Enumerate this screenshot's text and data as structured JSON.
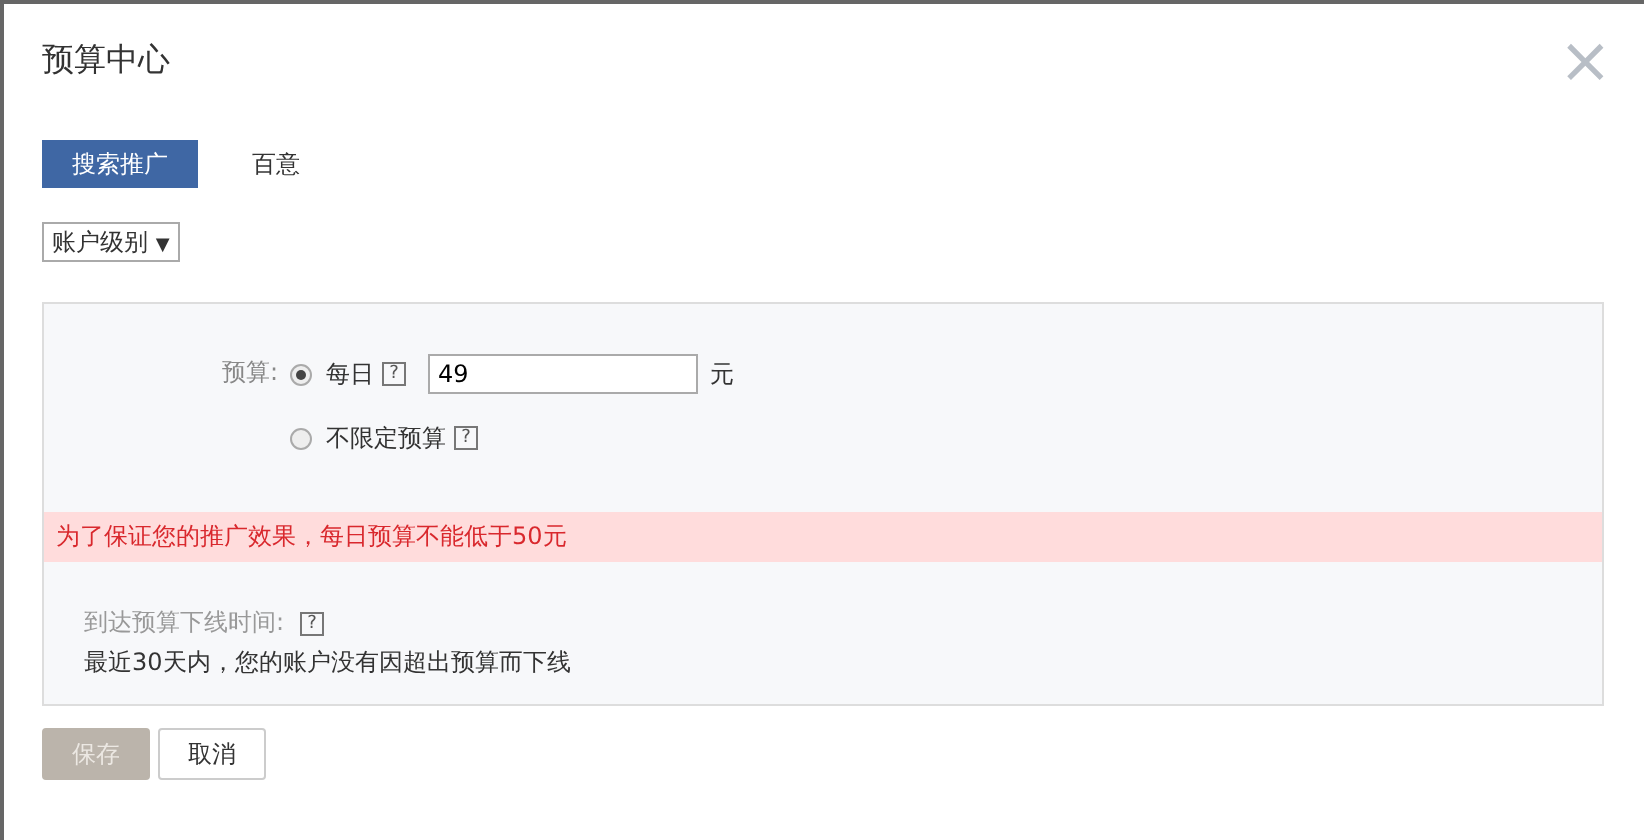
{
  "dialog": {
    "title": "预算中心",
    "close": "×"
  },
  "tabs": [
    {
      "label": "搜索推广",
      "selected": true
    },
    {
      "label": "百意",
      "selected": false
    }
  ],
  "level_select": {
    "value": "账户级别",
    "caret": "▼"
  },
  "budget": {
    "label": "预算:",
    "options": [
      {
        "label": "每日",
        "help": "?",
        "selected": true,
        "input": {
          "value": "49",
          "unit": "元"
        }
      },
      {
        "label": "不限定预算",
        "help": "?",
        "selected": false
      }
    ]
  },
  "error": "为了保证您的推广效果，每日预算不能低于50元",
  "offline": {
    "label": "到达预算下线时间:",
    "help": "?",
    "text": "最近30天内，您的账户没有因超出预算而下线"
  },
  "buttons": [
    {
      "label": "保存",
      "kind": "primary",
      "disabled": true
    },
    {
      "label": "取消",
      "kind": "secondary",
      "disabled": false
    }
  ]
}
